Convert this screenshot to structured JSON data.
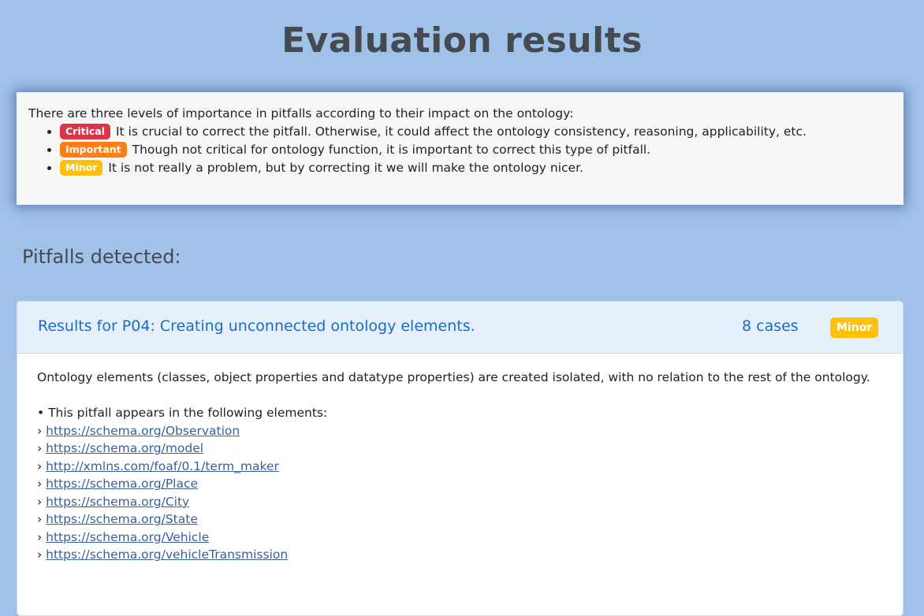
{
  "page": {
    "title": "Evaluation results"
  },
  "legend": {
    "intro": "There are three levels of importance in pitfalls according to their impact on the ontology:",
    "levels": [
      {
        "badge": "Critical",
        "text": "It is crucial to correct the pitfall. Otherwise, it could affect the ontology consistency, reasoning, applicability, etc.",
        "color": "#dc3545"
      },
      {
        "badge": "Important",
        "text": "Though not critical for ontology function, it is important to correct this type of pitfall.",
        "color": "#fd7e14"
      },
      {
        "badge": "Minor",
        "text": "It is not really a problem, but by correcting it we will make the ontology nicer.",
        "color": "#ffc107"
      }
    ]
  },
  "pitfalls": {
    "heading": "Pitfalls detected:",
    "results": [
      {
        "title": "Results for P04: Creating unconnected ontology elements.",
        "cases": "8 cases",
        "importance": "Minor",
        "description": "Ontology elements (classes, object properties and datatype properties) are created isolated, with no relation to the rest of the ontology.",
        "appears_label": "• This pitfall appears in the following elements:",
        "elements": [
          "https://schema.org/Observation",
          "https://schema.org/model",
          "http://xmlns.com/foaf/0.1/term_maker",
          "https://schema.org/Place",
          "https://schema.org/City",
          "https://schema.org/State",
          "https://schema.org/Vehicle",
          "https://schema.org/vehicleTransmission"
        ]
      }
    ]
  }
}
